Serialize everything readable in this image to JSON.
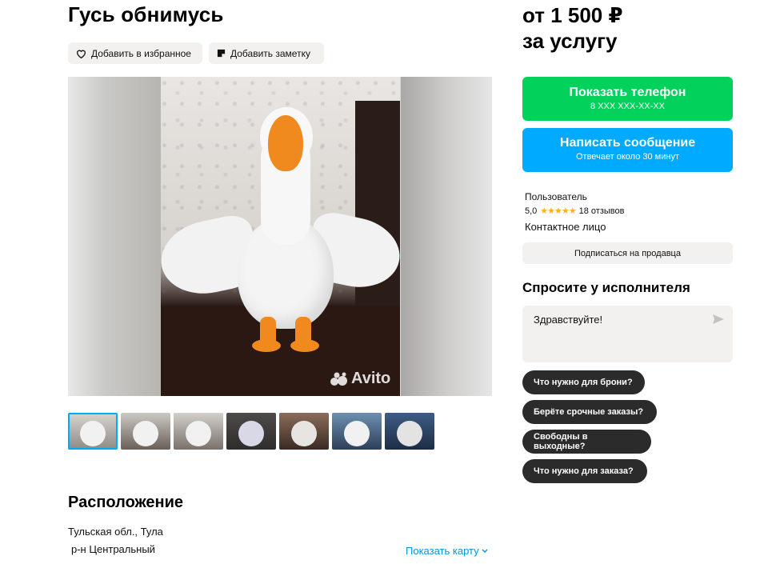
{
  "listing": {
    "title": "Гусь обнимусь",
    "favorite_label": "Добавить в избранное",
    "note_label": "Добавить заметку",
    "watermark": "Avito"
  },
  "location": {
    "section_title": "Расположение",
    "address_line1": "Тульская обл., Тула",
    "address_line2": "р-н Центральный",
    "map_link": "Показать карту"
  },
  "sidebar": {
    "price_line1": "от 1 500 ₽",
    "price_line2": "за услугу",
    "phone_button": "Показать телефон",
    "phone_number": "8 XXX XXX-XX-XX",
    "message_button": "Написать сообщение",
    "message_sub": "Отвечает около 30 минут",
    "seller_name": "Пользователь",
    "rating": "5,0",
    "stars": "★★★★★",
    "reviews": "18 отзывов",
    "contact_type": "Контактное лицо",
    "subscribe_label": "Подписаться на продавца",
    "ask_title": "Спросите у исполнителя",
    "ask_placeholder": "Здравствуйте!",
    "quick_questions": [
      "Что нужно для брони?",
      "Берёте срочные заказы?",
      "Свободны в выходные?",
      "Что нужно для заказа?"
    ]
  },
  "colors": {
    "phone_green": "#02d15c",
    "message_blue": "#00aaff",
    "link_blue": "#0096e0",
    "star_orange": "#ffb021",
    "chip_dark": "#2b2b2b"
  },
  "thumbnails": [
    "thumb-1",
    "thumb-2",
    "thumb-3",
    "thumb-4",
    "thumb-5",
    "thumb-6",
    "thumb-7"
  ]
}
